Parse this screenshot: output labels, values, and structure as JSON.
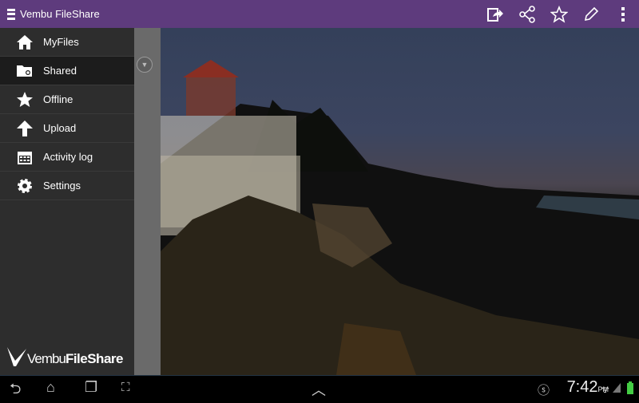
{
  "app": {
    "title": "Vembu FileShare"
  },
  "toolbar": {
    "actions": [
      "export-icon",
      "share-icon",
      "star-icon",
      "edit-icon",
      "overflow-menu-icon"
    ]
  },
  "sidebar": {
    "items": [
      {
        "label": "MyFiles",
        "icon": "home-icon"
      },
      {
        "label": "Shared",
        "icon": "shared-folder-icon",
        "selected": true
      },
      {
        "label": "Offline",
        "icon": "star-icon"
      },
      {
        "label": "Upload",
        "icon": "arrow-up-icon"
      },
      {
        "label": "Activity log",
        "icon": "calendar-icon"
      },
      {
        "label": "Settings",
        "icon": "gear-icon"
      }
    ]
  },
  "logo": {
    "part1": "Vembu",
    "part2": "FileShare"
  },
  "status": {
    "time": "7:42",
    "ampm": "PM"
  },
  "colors": {
    "accent": "#5e3b7d"
  }
}
